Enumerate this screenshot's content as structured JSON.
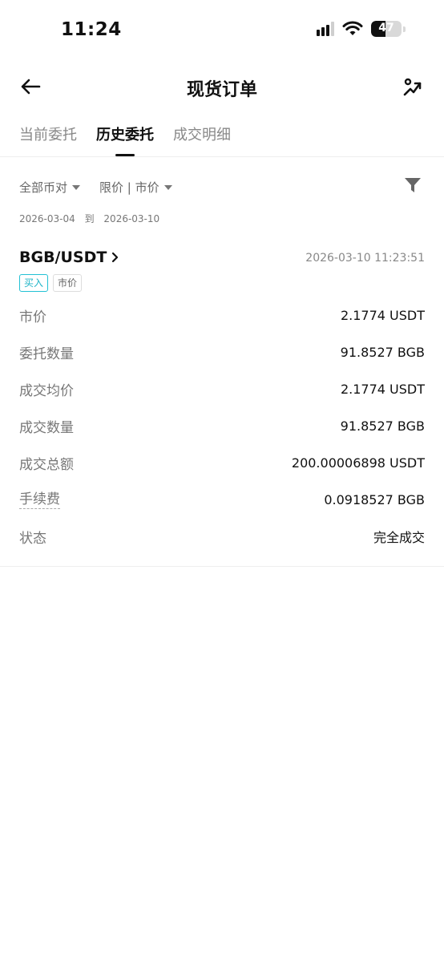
{
  "status_bar": {
    "time": "11:24",
    "battery_percent": "47",
    "battery_level": 0.47,
    "signal_bars_active": 3,
    "signal_bars_total": 4
  },
  "header": {
    "title": "现货订单",
    "back_icon": "arrow-left-icon",
    "share_icon": "share-icon"
  },
  "tabs": [
    {
      "label": "当前委托",
      "active": false
    },
    {
      "label": "历史委托",
      "active": true
    },
    {
      "label": "成交明细",
      "active": false
    }
  ],
  "filters": {
    "pair_filter": "全部币对",
    "type_filter": "限价 | 市价",
    "filter_icon": "funnel-icon"
  },
  "date_range": {
    "start": "2026-03-04",
    "separator": "到",
    "end": "2026-03-10"
  },
  "order": {
    "pair": "BGB/USDT",
    "time": "2026-03-10 11:23:51",
    "side_tag": "买入",
    "type_tag": "市价",
    "side_color": "#1fb4c7",
    "details": [
      {
        "label": "市价",
        "value": "2.1774 USDT"
      },
      {
        "label": "委托数量",
        "value": "91.8527 BGB"
      },
      {
        "label": "成交均价",
        "value": "2.1774 USDT"
      },
      {
        "label": "成交数量",
        "value": "91.8527 BGB"
      },
      {
        "label": "成交总额",
        "value": "200.00006898 USDT"
      },
      {
        "label": "手续费",
        "value": "0.0918527 BGB"
      },
      {
        "label": "状态",
        "value": "完全成交"
      }
    ]
  }
}
